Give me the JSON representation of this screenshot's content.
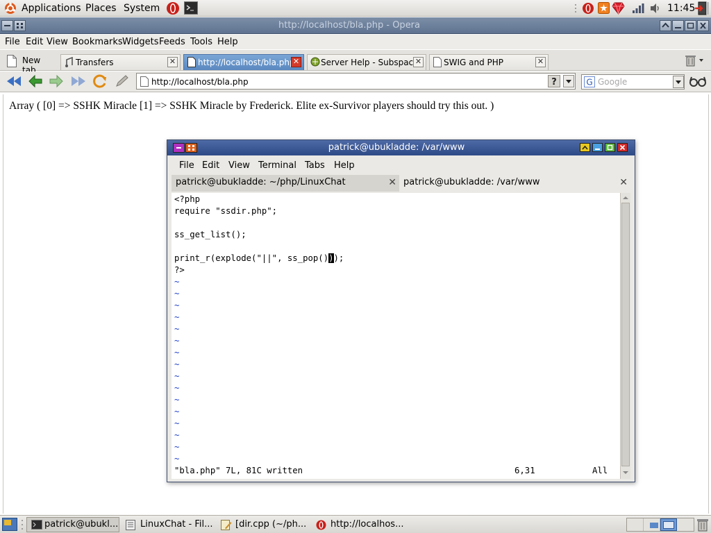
{
  "top_panel": {
    "menus": [
      "Applications",
      "Places",
      "System"
    ],
    "clock": "11:45"
  },
  "browser": {
    "window_title": "http://localhost/bla.php - Opera",
    "menu": [
      "File",
      "Edit",
      "View",
      "Bookmarks",
      "Widgets",
      "Feeds",
      "Tools",
      "Help"
    ],
    "new_tab_label": "New tab",
    "tabs": [
      {
        "label": "Transfers",
        "active": false
      },
      {
        "label": "http://localhost/bla.php",
        "active": true
      },
      {
        "label": "Server Help - Subspac...",
        "active": false
      },
      {
        "label": "SWIG and PHP",
        "active": false
      }
    ],
    "address": "http://localhost/bla.php",
    "search_placeholder": "Google",
    "page_output": "Array ( [0] => SSHK Miracle [1] => SSHK Miracle by Frederick. Elite ex-Survivor players should try this out. )"
  },
  "terminal": {
    "title": "patrick@ubukladde: /var/www",
    "menu": [
      "File",
      "Edit",
      "View",
      "Terminal",
      "Tabs",
      "Help"
    ],
    "tabs": [
      {
        "label": "patrick@ubukladde: ~/php/LinuxChat",
        "active": false
      },
      {
        "label": "patrick@ubukladde: /var/www",
        "active": true
      }
    ],
    "code_lines": [
      "<?php",
      "require \"ssdir.php\";",
      "",
      "ss_get_list();",
      "",
      "print_r(explode(\"||\", ss_pop()",
      "?>"
    ],
    "code_line_6_cursor": ")",
    "code_line_6_rest": ");",
    "status_message": "\"bla.php\" 7L, 81C written",
    "status_position": "6,31",
    "status_scroll": "All"
  },
  "taskbar": {
    "items": [
      {
        "label": "patrick@ubukl...",
        "active": true
      },
      {
        "label": "LinuxChat - Fil...",
        "active": false
      },
      {
        "label": "[dir.cpp (~/ph...",
        "active": false
      },
      {
        "label": "http://localhos...",
        "active": false
      }
    ]
  }
}
